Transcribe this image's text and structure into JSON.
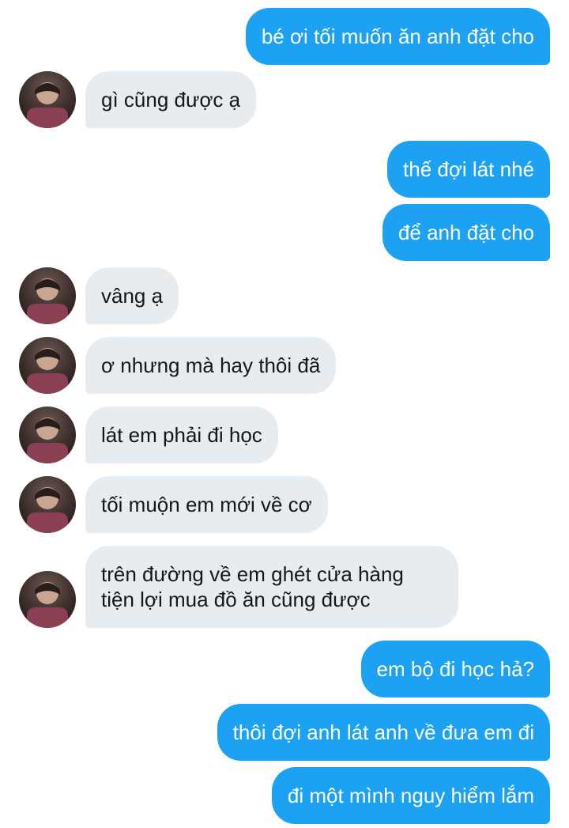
{
  "conversation": {
    "messages": [
      {
        "direction": "out",
        "text": "bé ơi tối muốn ăn anh đặt cho"
      },
      {
        "direction": "in",
        "text": "gì cũng được ạ"
      },
      {
        "direction": "out",
        "text": "thế đợi lát nhé"
      },
      {
        "direction": "out",
        "text": "để anh đặt cho"
      },
      {
        "direction": "in",
        "text": "vâng ạ"
      },
      {
        "direction": "in",
        "text": "ơ nhưng mà hay thôi đã"
      },
      {
        "direction": "in",
        "text": "lát em phải đi học"
      },
      {
        "direction": "in",
        "text": "tối muộn em mới về cơ"
      },
      {
        "direction": "in",
        "lines": [
          "trên đường về em ghét cửa hàng",
          "tiện lợi mua đồ ăn cũng được"
        ]
      },
      {
        "direction": "out",
        "text": "em bộ đi học hả?"
      },
      {
        "direction": "out",
        "text": "thôi đợi anh lát anh về đưa em đi"
      },
      {
        "direction": "out",
        "text": "đi một mình nguy hiểm lắm"
      }
    ]
  },
  "colors": {
    "outgoing_bubble": "#1da1f2",
    "incoming_bubble": "#e6ecf0",
    "outgoing_text": "#ffffff",
    "incoming_text": "#14171a"
  },
  "icons": {
    "avatar": "contact-avatar-photo"
  }
}
